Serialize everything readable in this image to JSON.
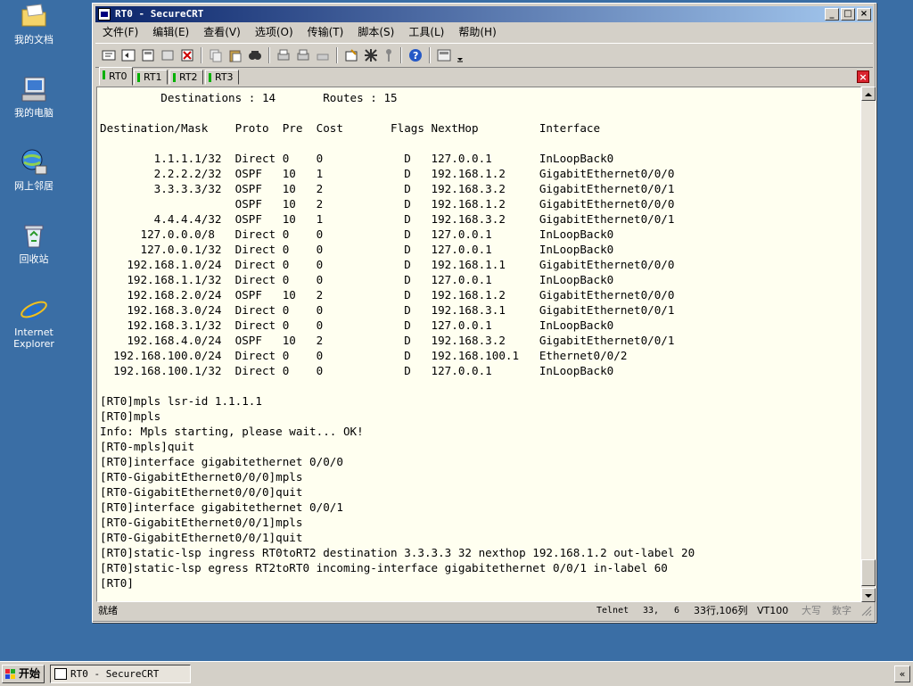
{
  "desktop": {
    "icons": [
      {
        "label": "我的文档"
      },
      {
        "label": "我的电脑"
      },
      {
        "label": "网上邻居"
      },
      {
        "label": "回收站"
      },
      {
        "label": "Internet Explorer"
      }
    ]
  },
  "window": {
    "title": "RT0 - SecureCRT",
    "menu": [
      "文件(F)",
      "编辑(E)",
      "查看(V)",
      "选项(O)",
      "传输(T)",
      "脚本(S)",
      "工具(L)",
      "帮助(H)"
    ],
    "tabs": [
      "RT0",
      "RT1",
      "RT2",
      "RT3"
    ],
    "active_tab": "RT0",
    "tab_close": "×",
    "terminal_lines": [
      "         Destinations : 14       Routes : 15",
      "",
      "Destination/Mask    Proto  Pre  Cost       Flags NextHop         Interface",
      "",
      "        1.1.1.1/32  Direct 0    0            D   127.0.0.1       InLoopBack0",
      "        2.2.2.2/32  OSPF   10   1            D   192.168.1.2     GigabitEthernet0/0/0",
      "        3.3.3.3/32  OSPF   10   2            D   192.168.3.2     GigabitEthernet0/0/1",
      "                    OSPF   10   2            D   192.168.1.2     GigabitEthernet0/0/0",
      "        4.4.4.4/32  OSPF   10   1            D   192.168.3.2     GigabitEthernet0/0/1",
      "      127.0.0.0/8   Direct 0    0            D   127.0.0.1       InLoopBack0",
      "      127.0.0.1/32  Direct 0    0            D   127.0.0.1       InLoopBack0",
      "    192.168.1.0/24  Direct 0    0            D   192.168.1.1     GigabitEthernet0/0/0",
      "    192.168.1.1/32  Direct 0    0            D   127.0.0.1       InLoopBack0",
      "    192.168.2.0/24  OSPF   10   2            D   192.168.1.2     GigabitEthernet0/0/0",
      "    192.168.3.0/24  Direct 0    0            D   192.168.3.1     GigabitEthernet0/0/1",
      "    192.168.3.1/32  Direct 0    0            D   127.0.0.1       InLoopBack0",
      "    192.168.4.0/24  OSPF   10   2            D   192.168.3.2     GigabitEthernet0/0/1",
      "  192.168.100.0/24  Direct 0    0            D   192.168.100.1   Ethernet0/0/2",
      "  192.168.100.1/32  Direct 0    0            D   127.0.0.1       InLoopBack0",
      "",
      "[RT0]mpls lsr-id 1.1.1.1",
      "[RT0]mpls",
      "Info: Mpls starting, please wait... OK!",
      "[RT0-mpls]quit",
      "[RT0]interface gigabitethernet 0/0/0",
      "[RT0-GigabitEthernet0/0/0]mpls",
      "[RT0-GigabitEthernet0/0/0]quit",
      "[RT0]interface gigabitethernet 0/0/1",
      "[RT0-GigabitEthernet0/0/1]mpls",
      "[RT0-GigabitEthernet0/0/1]quit",
      "[RT0]static-lsp ingress RT0toRT2 destination 3.3.3.3 32 nexthop 192.168.1.2 out-label 20",
      "[RT0]static-lsp egress RT2toRT0 incoming-interface gigabitethernet 0/0/1 in-label 60",
      "[RT0]"
    ],
    "status": {
      "ready": "就绪",
      "protocol": "Telnet",
      "row": "33,",
      "col": "6",
      "size": "33行,106列",
      "emulation": "VT100",
      "caps": "大写",
      "num": "数字"
    },
    "colors": {
      "tab_led": "#00b000",
      "terminal_bg": "#fffff0",
      "close_red": "#d9232e"
    }
  },
  "taskbar": {
    "start": "开始",
    "item": "RT0 - SecureCRT",
    "tray_arrow": "«"
  }
}
